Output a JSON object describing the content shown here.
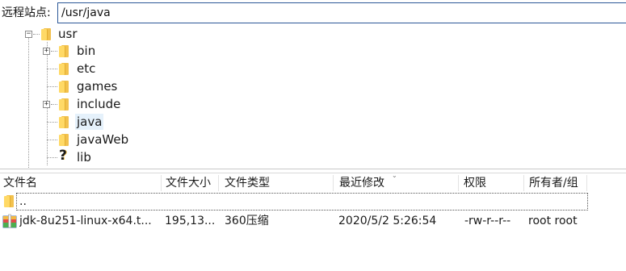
{
  "address": {
    "label": "远程站点:",
    "path": "/usr/java"
  },
  "tree": {
    "items": [
      {
        "label": "usr",
        "expander": "minus",
        "icon": "folder-icon"
      },
      {
        "label": "bin",
        "expander": "plus",
        "icon": "folder-icon"
      },
      {
        "label": "etc",
        "expander": "",
        "icon": "folder-icon"
      },
      {
        "label": "games",
        "expander": "",
        "icon": "folder-icon"
      },
      {
        "label": "include",
        "expander": "plus",
        "icon": "folder-icon"
      },
      {
        "label": "java",
        "expander": "",
        "icon": "folder-icon",
        "selected": true
      },
      {
        "label": "javaWeb",
        "expander": "",
        "icon": "folder-icon"
      },
      {
        "label": "lib",
        "expander": "",
        "icon": "question-mark-icon"
      }
    ]
  },
  "list": {
    "columns": [
      "文件名",
      "文件大小",
      "文件类型",
      "最近修改",
      "权限",
      "所有者/组"
    ],
    "rows": [
      {
        "name": "..",
        "size": "",
        "type": "",
        "modified": "",
        "perms": "",
        "owner": "",
        "icon": "folder-icon"
      },
      {
        "name": "jdk-8u251-linux-x64.t...",
        "size": "195,13...",
        "type": "360压缩",
        "modified": "2020/5/2 5:26:54",
        "perms": "-rw-r--r--",
        "owner": "root root",
        "icon": "archive-icon"
      }
    ]
  },
  "colors": {
    "folder": "#ffd966",
    "selection": "#e5f1fb",
    "address_border": "#2b5797"
  }
}
